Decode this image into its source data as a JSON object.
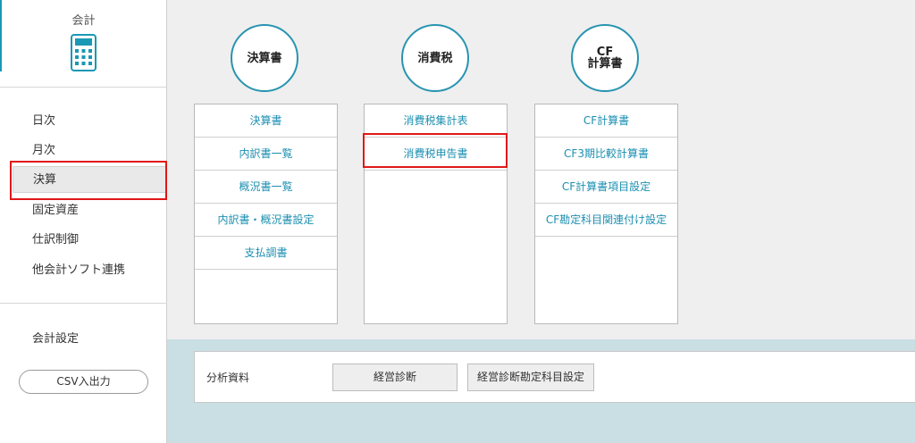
{
  "sidebar": {
    "app_title": "会計",
    "nav_items": [
      {
        "label": "日次"
      },
      {
        "label": "月次"
      },
      {
        "label": "決算"
      },
      {
        "label": "固定資産"
      },
      {
        "label": "仕訳制御"
      },
      {
        "label": "他会計ソフト連携"
      }
    ],
    "active_item": "決算",
    "settings_label": "会計設定",
    "csv_button_label": "CSV入出力"
  },
  "main": {
    "sections": [
      {
        "heading": "決算書",
        "items": [
          "決算書",
          "内訳書一覧",
          "概況書一覧",
          "内訳書・概況書設定",
          "支払調書"
        ]
      },
      {
        "heading": "消費税",
        "items": [
          "消費税集計表",
          "消費税申告書"
        ]
      },
      {
        "heading_line1": "CF",
        "heading_line2": "計算書",
        "items": [
          "CF計算書",
          "CF3期比較計算書",
          "CF計算書項目設定",
          "CF勘定科目関連付け設定"
        ]
      }
    ],
    "highlighted_item": "消費税申告書",
    "analysis": {
      "label": "分析資料",
      "buttons": [
        "経営診断",
        "経営診断勘定科目設定"
      ]
    }
  },
  "colors": {
    "accent": "#2894b0",
    "link": "#1c8fb1",
    "highlight": "#e01818",
    "main_bg": "#efefef",
    "bottom_bg": "#c9dfe4"
  },
  "icons": [
    "calculator-icon"
  ]
}
